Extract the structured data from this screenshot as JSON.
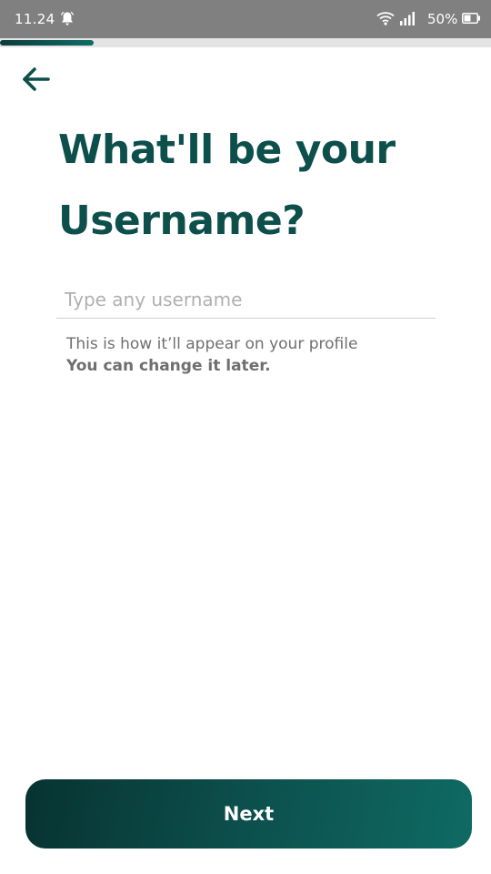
{
  "status_bar": {
    "time": "11.24",
    "battery_percent": "50%",
    "icons": [
      "bell-icon",
      "wifi-icon",
      "signal-icon",
      "battery-icon"
    ]
  },
  "progress": {
    "value_percent": 19
  },
  "header": {
    "back_icon": "arrow-left-icon"
  },
  "main": {
    "title": "What'll be your\nUsername?",
    "username_field": {
      "value": "",
      "placeholder": "Type any username"
    },
    "helper_line1": "This is how it’ll appear on your profile",
    "helper_line2": "You can change it later."
  },
  "footer": {
    "next_label": "Next"
  },
  "colors": {
    "accent": "#0d4f4b",
    "statusbar": "#808080",
    "progress_track": "#e4e4e4",
    "button_gradient_start": "#073331",
    "button_gradient_end": "#0f6a64"
  }
}
